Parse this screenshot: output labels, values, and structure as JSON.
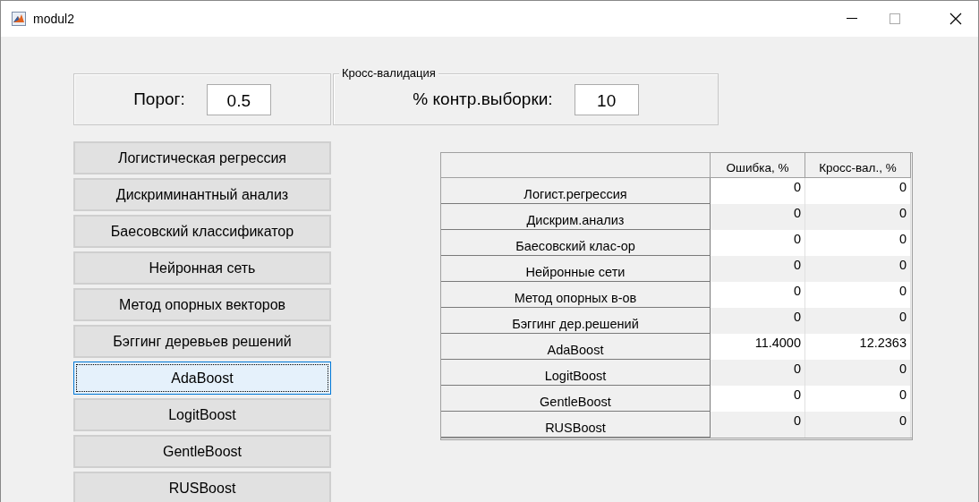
{
  "window": {
    "title": "modul2"
  },
  "threshold": {
    "label": "Порог:",
    "value": "0.5"
  },
  "cross_validation": {
    "title": "Кросс-валидация",
    "label": "% контр.выборки:",
    "value": "10"
  },
  "methods": [
    {
      "label": "Логистическая регрессия",
      "focused": false
    },
    {
      "label": "Дискриминантный анализ",
      "focused": false
    },
    {
      "label": "Баесовский классификатор",
      "focused": false
    },
    {
      "label": "Нейронная сеть",
      "focused": false
    },
    {
      "label": "Метод опорных векторов",
      "focused": false
    },
    {
      "label": "Бэггинг деревьев решений",
      "focused": false
    },
    {
      "label": "AdaBoost",
      "focused": true
    },
    {
      "label": "LogitBoost",
      "focused": false
    },
    {
      "label": "GentleBoost",
      "focused": false
    },
    {
      "label": "RUSBoost",
      "focused": false
    }
  ],
  "table": {
    "columns": [
      "Ошибка, %",
      "Кросс-вал., %"
    ],
    "rows": [
      {
        "name": "Логист.регрессия",
        "values": [
          "0",
          "0"
        ]
      },
      {
        "name": "Дискрим.анализ",
        "values": [
          "0",
          "0"
        ]
      },
      {
        "name": "Баесовский клас-ор",
        "values": [
          "0",
          "0"
        ]
      },
      {
        "name": "Нейронные сети",
        "values": [
          "0",
          "0"
        ]
      },
      {
        "name": "Метод опорных в-ов",
        "values": [
          "0",
          "0"
        ]
      },
      {
        "name": "Бэггинг дер.решений",
        "values": [
          "0",
          "0"
        ]
      },
      {
        "name": "AdaBoost",
        "values": [
          "11.4000",
          "12.2363"
        ]
      },
      {
        "name": "LogitBoost",
        "values": [
          "0",
          "0"
        ]
      },
      {
        "name": "GentleBoost",
        "values": [
          "0",
          "0"
        ]
      },
      {
        "name": "RUSBoost",
        "values": [
          "0",
          "0"
        ]
      }
    ]
  }
}
